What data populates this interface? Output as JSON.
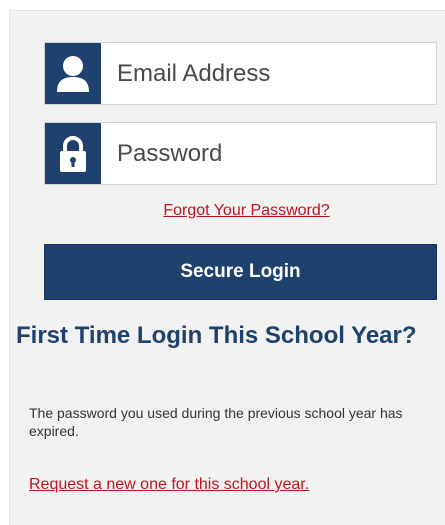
{
  "login": {
    "email_placeholder": "Email Address",
    "email_icon": "user-icon",
    "password_placeholder": "Password",
    "password_icon": "lock-icon",
    "forgot_link": "Forgot Your Password?",
    "submit_label": "Secure Login"
  },
  "first_time": {
    "heading": "First Time Login This School Year?",
    "description": "The password you used during the previous school year has expired.",
    "request_link": "Request a new one for this school year."
  },
  "colors": {
    "brand_navy": "#1f416d",
    "link_red": "#c0141c",
    "panel_bg": "#f2f2f2"
  }
}
